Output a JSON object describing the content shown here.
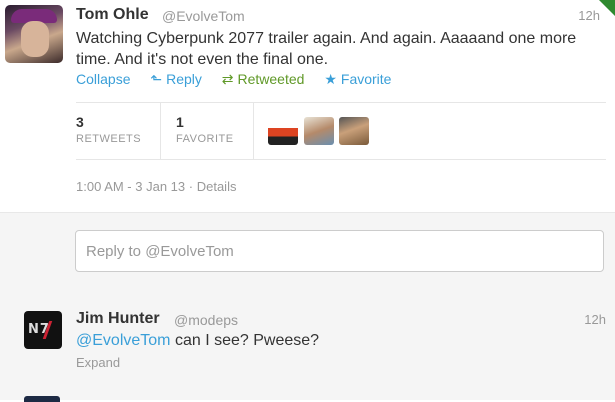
{
  "tweet": {
    "author_name": "Tom Ohle",
    "author_handle": "@EvolveTom",
    "time": "12h",
    "text": "Watching Cyberpunk 2077 trailer again. And again. Aaaaand one more time. And it's not even the final one.",
    "actions": {
      "collapse": "Collapse",
      "reply": "Reply",
      "retweeted": "Retweeted",
      "favorite": "Favorite"
    },
    "stats": {
      "retweets_count": "3",
      "retweets_label": "RETWEETS",
      "favorites_count": "1",
      "favorites_label": "FAVORITE"
    },
    "timestamp": "1:00 AM - 3 Jan 13",
    "details_label": "Details",
    "meta_separator": "·"
  },
  "reply_box": {
    "placeholder": "Reply to @EvolveTom"
  },
  "reply_tweet": {
    "author_name": "Jim Hunter",
    "author_handle": "@modeps",
    "time": "12h",
    "mention": "@EvolveTom",
    "text": "can I see? Pweese?",
    "expand": "Expand",
    "avatar_text": "N7"
  },
  "colors": {
    "link": "#3a9fd8",
    "retweeted": "#609928",
    "muted": "#999999"
  },
  "icons": {
    "reply": "reply-arrow",
    "retweet": "retweet-arrows",
    "favorite": "star"
  }
}
